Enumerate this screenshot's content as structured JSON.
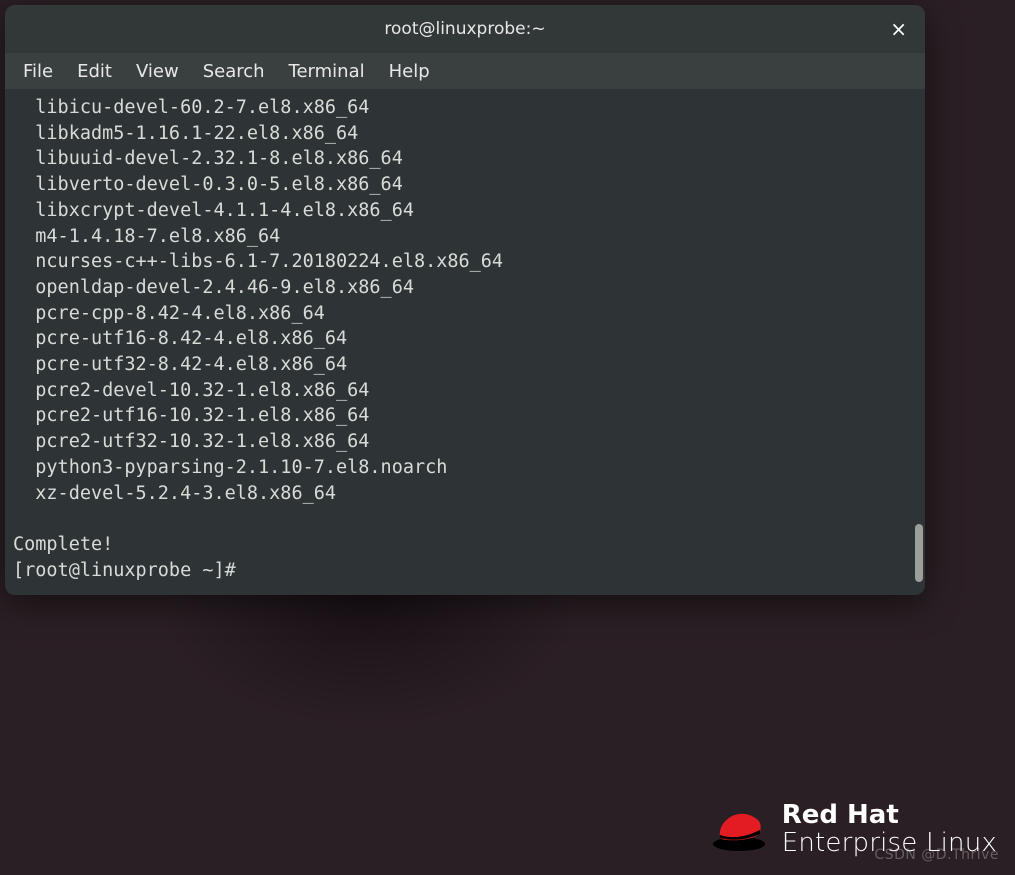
{
  "window": {
    "title": "root@linuxprobe:~",
    "close": "×"
  },
  "menu": {
    "file": "File",
    "edit": "Edit",
    "view": "View",
    "search": "Search",
    "terminal": "Terminal",
    "help": "Help"
  },
  "terminal": {
    "packages": [
      "  libicu-devel-60.2-7.el8.x86_64",
      "  libkadm5-1.16.1-22.el8.x86_64",
      "  libuuid-devel-2.32.1-8.el8.x86_64",
      "  libverto-devel-0.3.0-5.el8.x86_64",
      "  libxcrypt-devel-4.1.1-4.el8.x86_64",
      "  m4-1.4.18-7.el8.x86_64",
      "  ncurses-c++-libs-6.1-7.20180224.el8.x86_64",
      "  openldap-devel-2.4.46-9.el8.x86_64",
      "  pcre-cpp-8.42-4.el8.x86_64",
      "  pcre-utf16-8.42-4.el8.x86_64",
      "  pcre-utf32-8.42-4.el8.x86_64",
      "  pcre2-devel-10.32-1.el8.x86_64",
      "  pcre2-utf16-10.32-1.el8.x86_64",
      "  pcre2-utf32-10.32-1.el8.x86_64",
      "  python3-pyparsing-2.1.10-7.el8.noarch",
      "  xz-devel-5.2.4-3.el8.x86_64"
    ],
    "status": "Complete!",
    "prompt": "[root@linuxprobe ~]# "
  },
  "branding": {
    "line1": "Red Hat",
    "line2": "Enterprise Linux"
  },
  "watermark": "CSDN @D.Thrive"
}
